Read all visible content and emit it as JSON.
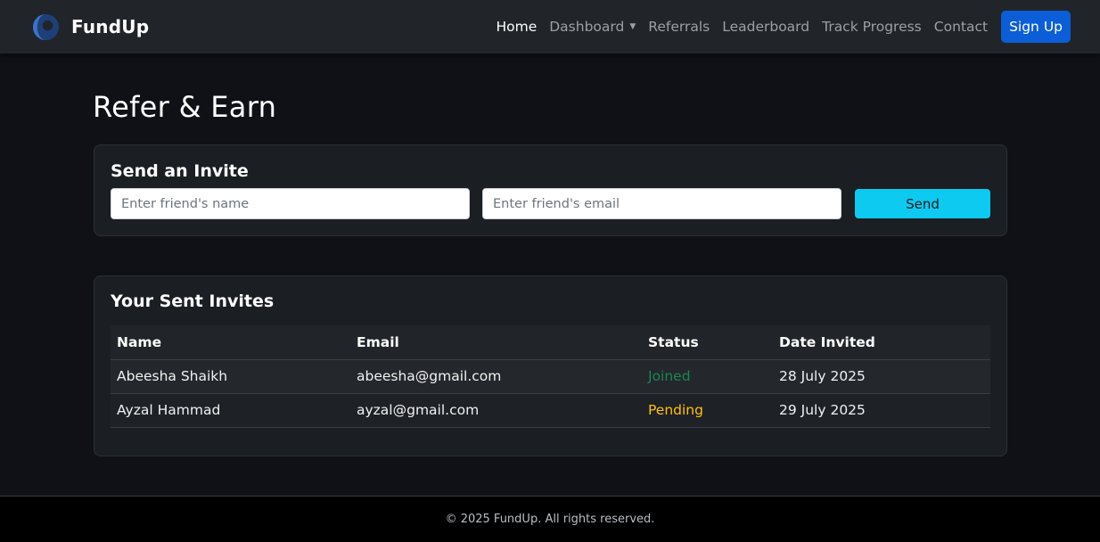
{
  "brand": {
    "name": "FundUp"
  },
  "nav": {
    "items": [
      {
        "label": "Home",
        "active": true
      },
      {
        "label": "Dashboard",
        "dropdown": true
      },
      {
        "label": "Referrals"
      },
      {
        "label": "Leaderboard"
      },
      {
        "label": "Track Progress"
      },
      {
        "label": "Contact"
      }
    ],
    "signup_label": "Sign Up"
  },
  "page": {
    "title": "Refer & Earn"
  },
  "invite": {
    "title": "Send an Invite",
    "name_placeholder": "Enter friend's name",
    "email_placeholder": "Enter friend's email",
    "send_label": "Send"
  },
  "sent": {
    "title": "Your Sent Invites",
    "columns": [
      "Name",
      "Email",
      "Status",
      "Date Invited"
    ],
    "rows": [
      {
        "name": "Abeesha Shaikh",
        "email": "abeesha@gmail.com",
        "status": "Joined",
        "status_color": "#198754",
        "date": "28 July 2025"
      },
      {
        "name": "Ayzal Hammad",
        "email": "ayzal@gmail.com",
        "status": "Pending",
        "status_color": "#ffc107",
        "date": "29 July 2025"
      }
    ]
  },
  "footer": {
    "text": "© 2025 FundUp. All rights reserved."
  },
  "colors": {
    "navbar_bg": "#212529",
    "page_bg": "#0f1117",
    "primary": "#0b5ed7",
    "info": "#0dcaf0"
  }
}
